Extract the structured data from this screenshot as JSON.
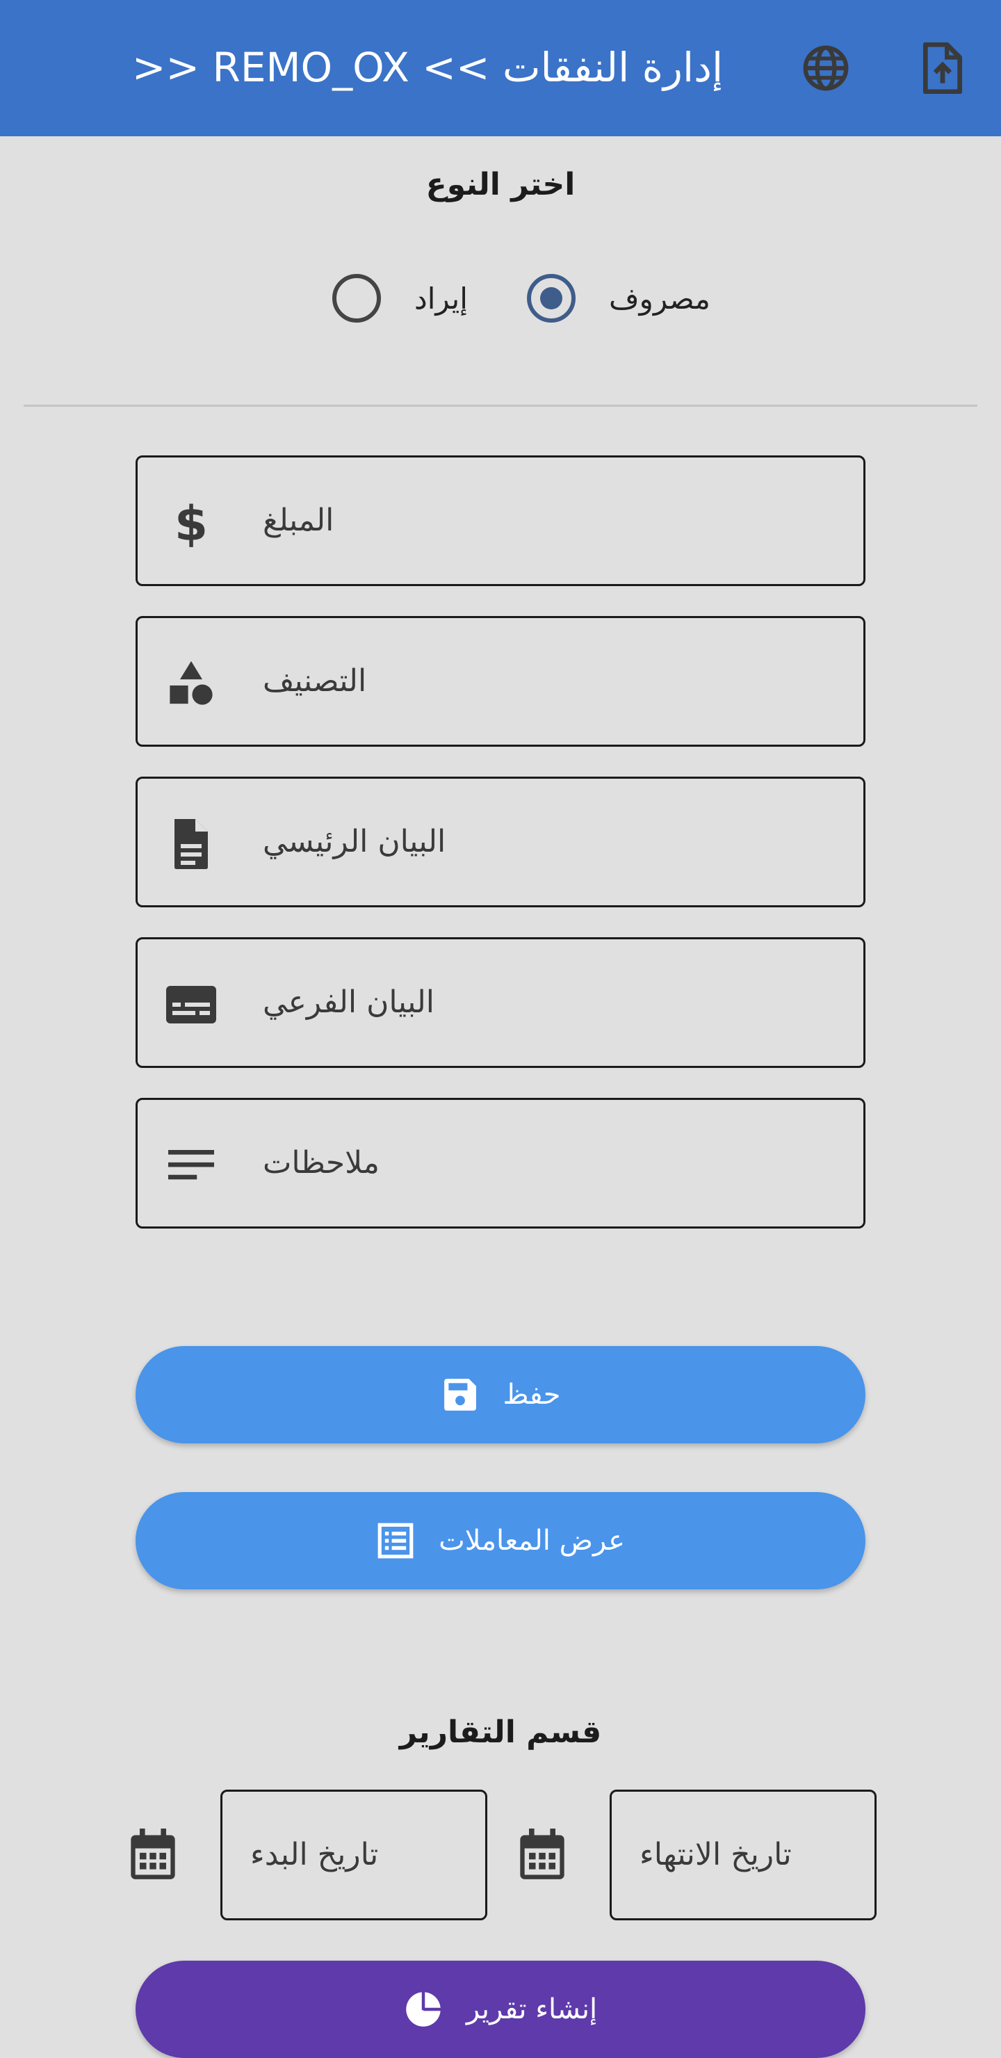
{
  "appbar": {
    "title": ">> REMO_OX << إدارة النفقات",
    "color": "#3a73c8",
    "icons": [
      "globe-icon",
      "file-upload-icon"
    ]
  },
  "type_section": {
    "title": "اختر النوع",
    "options": [
      {
        "label": "مصروف",
        "selected": true
      },
      {
        "label": "إيراد",
        "selected": false
      }
    ]
  },
  "form": {
    "fields": [
      {
        "label": "المبلغ",
        "icon": "dollar-icon"
      },
      {
        "label": "التصنيف",
        "icon": "category-icon"
      },
      {
        "label": "البيان الرئيسي",
        "icon": "document-icon"
      },
      {
        "label": "البيان الفرعي",
        "icon": "subtitles-icon"
      },
      {
        "label": "ملاحظات",
        "icon": "notes-icon"
      }
    ]
  },
  "buttons": {
    "save": {
      "label": "حفظ",
      "icon": "save-icon",
      "color": "#4a94ea"
    },
    "view": {
      "label": "عرض المعاملات",
      "icon": "list-icon",
      "color": "#4a94ea"
    }
  },
  "reports": {
    "title": "قسم التقارير",
    "end_date": {
      "placeholder": "تاريخ الانتهاء",
      "icon": "calendar-icon"
    },
    "start_date": {
      "placeholder": "تاريخ البدء",
      "icon": "calendar-icon"
    },
    "create": {
      "label": "إنشاء تقرير",
      "icon": "pie-chart-icon",
      "color": "#5e3aab"
    }
  }
}
